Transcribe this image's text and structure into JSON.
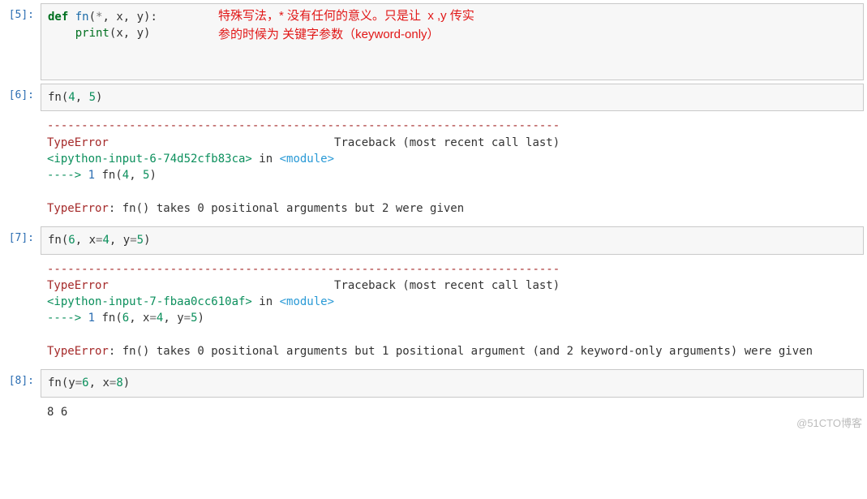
{
  "cells": [
    {
      "prompt": "[5]:",
      "annotation": "特殊写法，* 没有任何的意义。只是让  x ,y 传实\n参的时候为 关键字参数（keyword-only）"
    },
    {
      "prompt": "[6]:"
    },
    {
      "prompt": "[7]:"
    },
    {
      "prompt": "[8]:"
    }
  ],
  "code": {
    "c5": {
      "def": "def",
      "fn": " fn",
      "sig_open": "(",
      "star": "*",
      "c1": ", x, y",
      "sig_close": ")",
      "colon": ":",
      "indent": "    ",
      "print": "print",
      "p_open": "(",
      "args": "x, y",
      "p_close": ")"
    },
    "c6": {
      "fn": "fn",
      "open": "(",
      "a": "4",
      "c": ", ",
      "b": "5",
      "close": ")"
    },
    "c7": {
      "fn": "fn",
      "open": "(",
      "a": "6",
      "c1": ", x",
      "eq1": "=",
      "v1": "4",
      "c2": ", y",
      "eq2": "=",
      "v2": "5",
      "close": ")"
    },
    "c8": {
      "fn": "fn",
      "open": "(",
      "k1": "y",
      "eq1": "=",
      "v1": "6",
      "c": ", ",
      "k2": "x",
      "eq2": "=",
      "v2": "8",
      "close": ")"
    }
  },
  "tb": {
    "dash": "---------------------------------------------------------------------------",
    "type": "TypeError",
    "tbtext": "Traceback (most recent call last)",
    "loc6": "<ipython-input-6-74d52cfb83ca>",
    "loc7": "<ipython-input-7-fbaa0cc610af>",
    "in": " in ",
    "module": "<module>",
    "arrow": "----> ",
    "lineno": "1",
    "call6_fn": " fn",
    "call6_open": "(",
    "call6_a": "4",
    "call6_c": ", ",
    "call6_b": "5",
    "call6_close": ")",
    "call7_fn": " fn",
    "call7_open": "(",
    "call7_a": "6",
    "call7_c1": ", x",
    "call7_eq1": "=",
    "call7_v1": "4",
    "call7_c2": ", y",
    "call7_eq2": "=",
    "call7_v2": "5",
    "call7_close": ")",
    "msg6": ": fn() takes 0 positional arguments but 2 were given",
    "msg7": ": fn() takes 0 positional arguments but 1 positional argument (and 2 keyword-only arguments) were given"
  },
  "out8": "8 6",
  "watermark": "@51CTO博客"
}
